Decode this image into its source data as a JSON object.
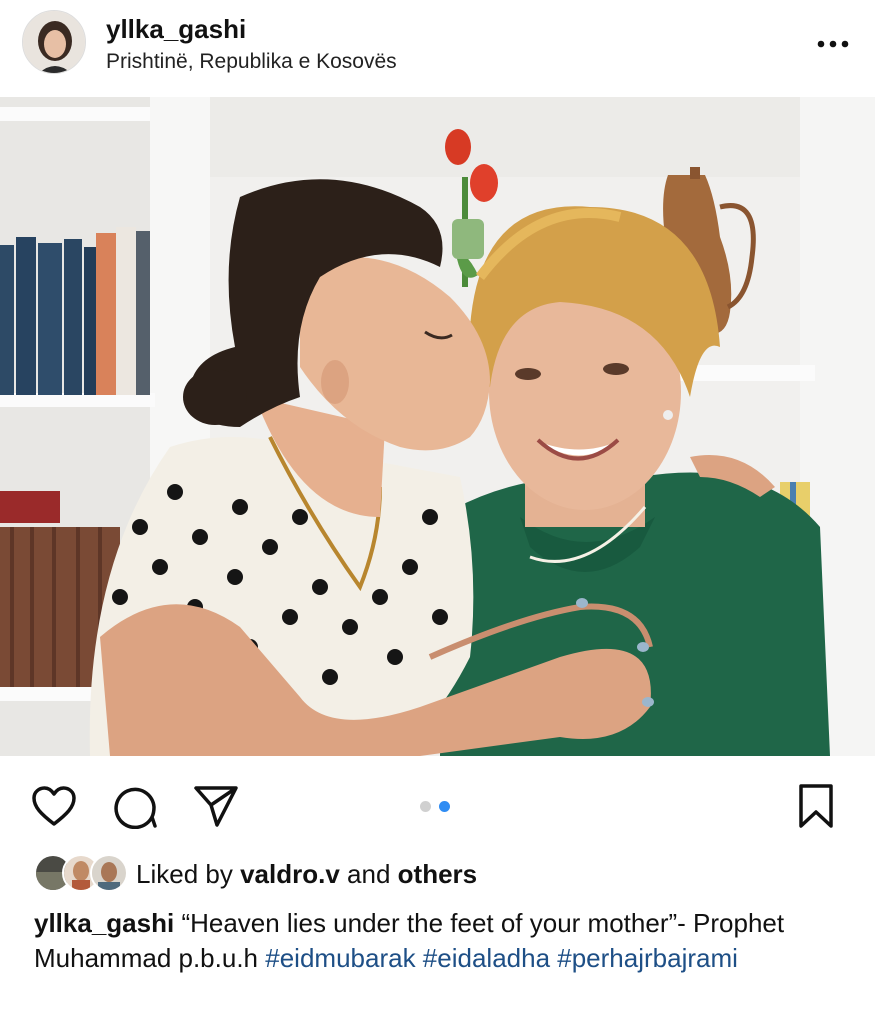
{
  "post": {
    "username": "yllka_gashi",
    "location": "Prishtinë, Republika e Kosovës",
    "more_icon": "more-horizontal-icon"
  },
  "photo": {
    "carousel_index": 2,
    "carousel_count": 2
  },
  "actions": {
    "like_icon": "heart-icon",
    "comment_icon": "comment-icon",
    "share_icon": "send-icon",
    "save_icon": "bookmark-icon"
  },
  "likes": {
    "prefix": "Liked by",
    "user": "valdro.v",
    "joiner": "and",
    "others": "others"
  },
  "caption": {
    "username": "yllka_gashi",
    "text": "“Heaven lies under the feet of your mother”- Prophet Muhammad p.b.u.h",
    "hashtags": [
      "#eidmubarak",
      "#eidaladha",
      "#perhajrbajrami"
    ]
  },
  "colors": {
    "accent_blue": "#2f8cf3",
    "hashtag": "#1e4f86",
    "text": "#111111"
  }
}
